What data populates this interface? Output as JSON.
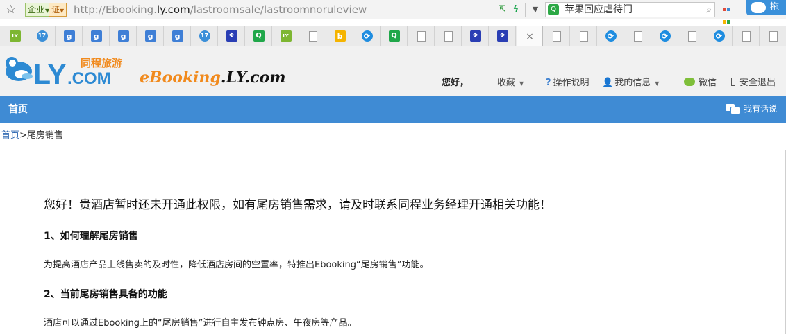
{
  "browser": {
    "url_prefix": "http://Ebooking.",
    "url_domain": "ly.com",
    "url_path": "/lastroomsale/lastroomnoruleview",
    "enterprise_badge": "企业",
    "cert_badge": "证",
    "search_text": "苹果回应虐待门",
    "cloud_button": "拖"
  },
  "tabs": [
    {
      "icon": "ly-favicon",
      "text": "LY"
    },
    {
      "icon": "cat-favicon",
      "text": "17"
    },
    {
      "icon": "g-favicon",
      "text": "g"
    },
    {
      "icon": "g-favicon",
      "text": "g"
    },
    {
      "icon": "g-favicon",
      "text": "g"
    },
    {
      "icon": "g-favicon",
      "text": "g"
    },
    {
      "icon": "g-favicon",
      "text": "g"
    },
    {
      "icon": "cat-favicon",
      "text": "17"
    },
    {
      "icon": "paw-favicon",
      "text": "❖"
    },
    {
      "icon": "search-favicon",
      "text": "Q"
    },
    {
      "icon": "ly-favicon",
      "text": "LY"
    },
    {
      "icon": "document-favicon",
      "text": ""
    },
    {
      "icon": "bing-favicon",
      "text": "b"
    },
    {
      "icon": "refresh-favicon",
      "text": "⟳"
    },
    {
      "icon": "search-favicon",
      "text": "Q"
    },
    {
      "icon": "document-favicon",
      "text": ""
    },
    {
      "icon": "document-favicon",
      "text": ""
    },
    {
      "icon": "paw-favicon",
      "text": "❖"
    },
    {
      "icon": "paw-favicon",
      "text": "❖"
    },
    {
      "icon": "close-icon",
      "text": "×"
    },
    {
      "icon": "document-favicon",
      "text": ""
    },
    {
      "icon": "document-favicon",
      "text": ""
    },
    {
      "icon": "refresh-favicon",
      "text": "⟳"
    },
    {
      "icon": "document-favicon",
      "text": ""
    },
    {
      "icon": "refresh-favicon",
      "text": "⟳"
    },
    {
      "icon": "document-favicon",
      "text": ""
    },
    {
      "icon": "refresh-favicon",
      "text": "⟳"
    },
    {
      "icon": "document-favicon",
      "text": ""
    },
    {
      "icon": "document-favicon",
      "text": ""
    }
  ],
  "header": {
    "logo_ly": "LY",
    "logo_com": ".COM",
    "logo_cn": "同程旅游",
    "brand_e": "eBooking",
    "brand_rest": ".LY.com",
    "greeting": "您好，",
    "favorites": "收藏",
    "help": "操作说明",
    "my_info": "我的信息",
    "wechat": "微信",
    "logout": "安全退出"
  },
  "nav": {
    "home": "首页",
    "feedback": "我有话说"
  },
  "breadcrumb": {
    "home": "首页",
    "sep": ">",
    "current": "尾房销售"
  },
  "content": {
    "notice": "您好！贵酒店暂时还未开通此权限，如有尾房销售需求，请及时联系同程业务经理开通相关功能！",
    "section1_title": "1、如何理解尾房销售",
    "section1_body": "为提高酒店产品上线售卖的及时性，降低酒店房间的空置率，特推出Ebooking“尾房销售”功能。",
    "section2_title": "2、当前尾房销售具备的功能",
    "section2_body": "酒店可以通过Ebooking上的“尾房销售”进行自主发布钟点房、午夜房等产品。"
  },
  "colors": {
    "brand_blue": "#3f8bd4",
    "brand_orange": "#f18a1d",
    "link_blue": "#2a64b0"
  }
}
